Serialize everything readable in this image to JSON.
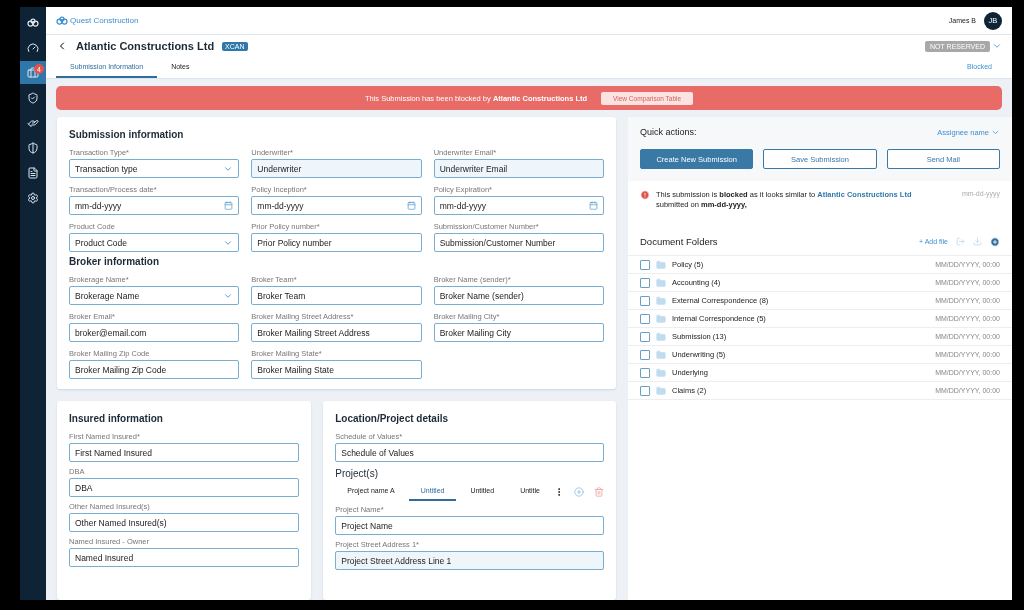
{
  "brand": "Quest Construction",
  "user": {
    "name": "James B",
    "initials": "JB"
  },
  "sidebar": {
    "items": [
      {
        "kind": "logo",
        "selected": false
      },
      {
        "kind": "gauge",
        "selected": false
      },
      {
        "kind": "briefcase",
        "selected": true,
        "badge": "4"
      },
      {
        "kind": "shield",
        "selected": false
      },
      {
        "kind": "hand",
        "selected": false
      },
      {
        "kind": "lock",
        "selected": false
      },
      {
        "kind": "document",
        "selected": false
      },
      {
        "kind": "settings",
        "selected": false
      }
    ]
  },
  "title": {
    "text": "Atlantic Constructions Ltd",
    "tag": "XCAN",
    "status": "NOT RESERVED",
    "state_link": "Blocked"
  },
  "tabs": [
    {
      "label": "Submission Information",
      "selected": true
    },
    {
      "label": "Notes",
      "selected": false
    }
  ],
  "banner": {
    "text": "This Submission has been blocked by **Atlantic Constructions Ltd**",
    "button": "View Comparison Table"
  },
  "submission_card": {
    "sections": [
      {
        "title": "Submission information",
        "fields": [
          {
            "label": "Transaction Type*",
            "value": "Transaction type",
            "kind": "select",
            "prefilled": false
          },
          {
            "label": "Underwriter*",
            "value": "Underwriter",
            "kind": "text",
            "prefilled": true
          },
          {
            "label": "Underwriter Email*",
            "value": "Underwriter Email",
            "kind": "text",
            "prefilled": true
          },
          {
            "label": "Transaction/Process date*",
            "value": "mm-dd-yyyy",
            "kind": "date",
            "prefilled": false
          },
          {
            "label": "Policy Inception*",
            "value": "mm-dd-yyyy",
            "kind": "date",
            "prefilled": false
          },
          {
            "label": "Policy Expiration*",
            "value": "mm-dd-yyyy",
            "kind": "date",
            "prefilled": false
          },
          {
            "label": "Product Code",
            "value": "Product Code",
            "kind": "select",
            "prefilled": false
          },
          {
            "label": "Prior Policy number*",
            "value": "Prior Policy number",
            "kind": "text",
            "prefilled": false
          },
          {
            "label": "Submission/Customer Number*",
            "value": "Submission/Customer Number",
            "kind": "text",
            "prefilled": false
          }
        ]
      },
      {
        "title": "Broker information",
        "fields": [
          {
            "label": "Brokerage Name*",
            "value": "Brokerage Name",
            "kind": "select",
            "prefilled": false
          },
          {
            "label": "Broker Team*",
            "value": "Broker Team",
            "kind": "text",
            "prefilled": false
          },
          {
            "label": "Broker Name (sender)*",
            "value": "Broker Name (sender)",
            "kind": "text",
            "prefilled": false
          },
          {
            "label": "Broker Email*",
            "value": "broker@email.com",
            "kind": "text",
            "prefilled": false
          },
          {
            "label": "Broker Mailing Street Address*",
            "value": "Broker Mailing Street Address",
            "kind": "text",
            "prefilled": false
          },
          {
            "label": "Broker Mailing City*",
            "value": "Broker Mailing City",
            "kind": "text",
            "prefilled": false
          },
          {
            "label": "Broker Mailing Zip Code",
            "value": "Broker Mailing Zip Code",
            "kind": "text",
            "prefilled": false
          },
          {
            "label": "Broker Mailing State*",
            "value": "Broker Mailing State",
            "kind": "text",
            "prefilled": false
          }
        ]
      }
    ]
  },
  "insured_card": {
    "title": "Insured information",
    "fields": [
      {
        "label": "First Named Insured*",
        "value": "First Named Insured",
        "prefilled": false
      },
      {
        "label": "DBA",
        "value": "DBA",
        "prefilled": false
      },
      {
        "label": "Other Named Insured(s)",
        "value": "Other Named Insured(s)",
        "prefilled": false
      },
      {
        "label": "Named Insured - Owner",
        "value": "Named Insured",
        "prefilled": false
      }
    ]
  },
  "location_card": {
    "title": "Location/Project details",
    "fields": [
      {
        "label": "Schedule of Values*",
        "value": "Schedule of Values",
        "prefilled": false
      }
    ],
    "projects_title": "Project(s)",
    "project_tabs": [
      {
        "label": "Project name A",
        "selected": false
      },
      {
        "label": "Untitled",
        "selected": true
      },
      {
        "label": "Untitled",
        "selected": false
      },
      {
        "label": "Untitle",
        "selected": false
      }
    ],
    "project_fields": [
      {
        "label": "Project Name*",
        "value": "Project Name",
        "prefilled": false
      },
      {
        "label": "Project Street Address 1*",
        "value": "Project Street Address Line 1",
        "prefilled": true
      }
    ]
  },
  "quick_actions": {
    "title": "Quick actions:",
    "assignee": "Assignee name",
    "buttons": [
      {
        "label": "Create New Submission",
        "kind": "primary"
      },
      {
        "label": "Save Submission",
        "kind": "outline"
      },
      {
        "label": "Send Mail",
        "kind": "outline"
      }
    ]
  },
  "alert": {
    "text": "This submission is **blocked** as it looks similar to",
    "link": "Atlantic Constructions Ltd",
    "text_after": "submitted on **mm-dd-yyyy,**",
    "date": "mm-dd-yyyy"
  },
  "documents": {
    "title": "Document Folders",
    "add": "+ Add file",
    "folders": [
      {
        "name": "Policy (5)",
        "date": "MM/DD/YYYY, 00:00",
        "checked": false
      },
      {
        "name": "Accounting (4)",
        "date": "MM/DD/YYYY, 00:00",
        "checked": false
      },
      {
        "name": "External Correspondence (8)",
        "date": "MM/DD/YYYY, 00:00",
        "checked": false
      },
      {
        "name": "Internal Correspondence (5)",
        "date": "MM/DD/YYYY, 00:00",
        "checked": false
      },
      {
        "name": "Submission (13)",
        "date": "MM/DD/YYYY, 00:00",
        "checked": false
      },
      {
        "name": "Underwriting (5)",
        "date": "MM/DD/YYYY, 00:00",
        "checked": false
      },
      {
        "name": "Underlying",
        "date": "MM/DD/YYYY, 00:00",
        "checked": false
      },
      {
        "name": "Claims (2)",
        "date": "MM/DD/YYYY, 00:00",
        "checked": false
      }
    ]
  }
}
